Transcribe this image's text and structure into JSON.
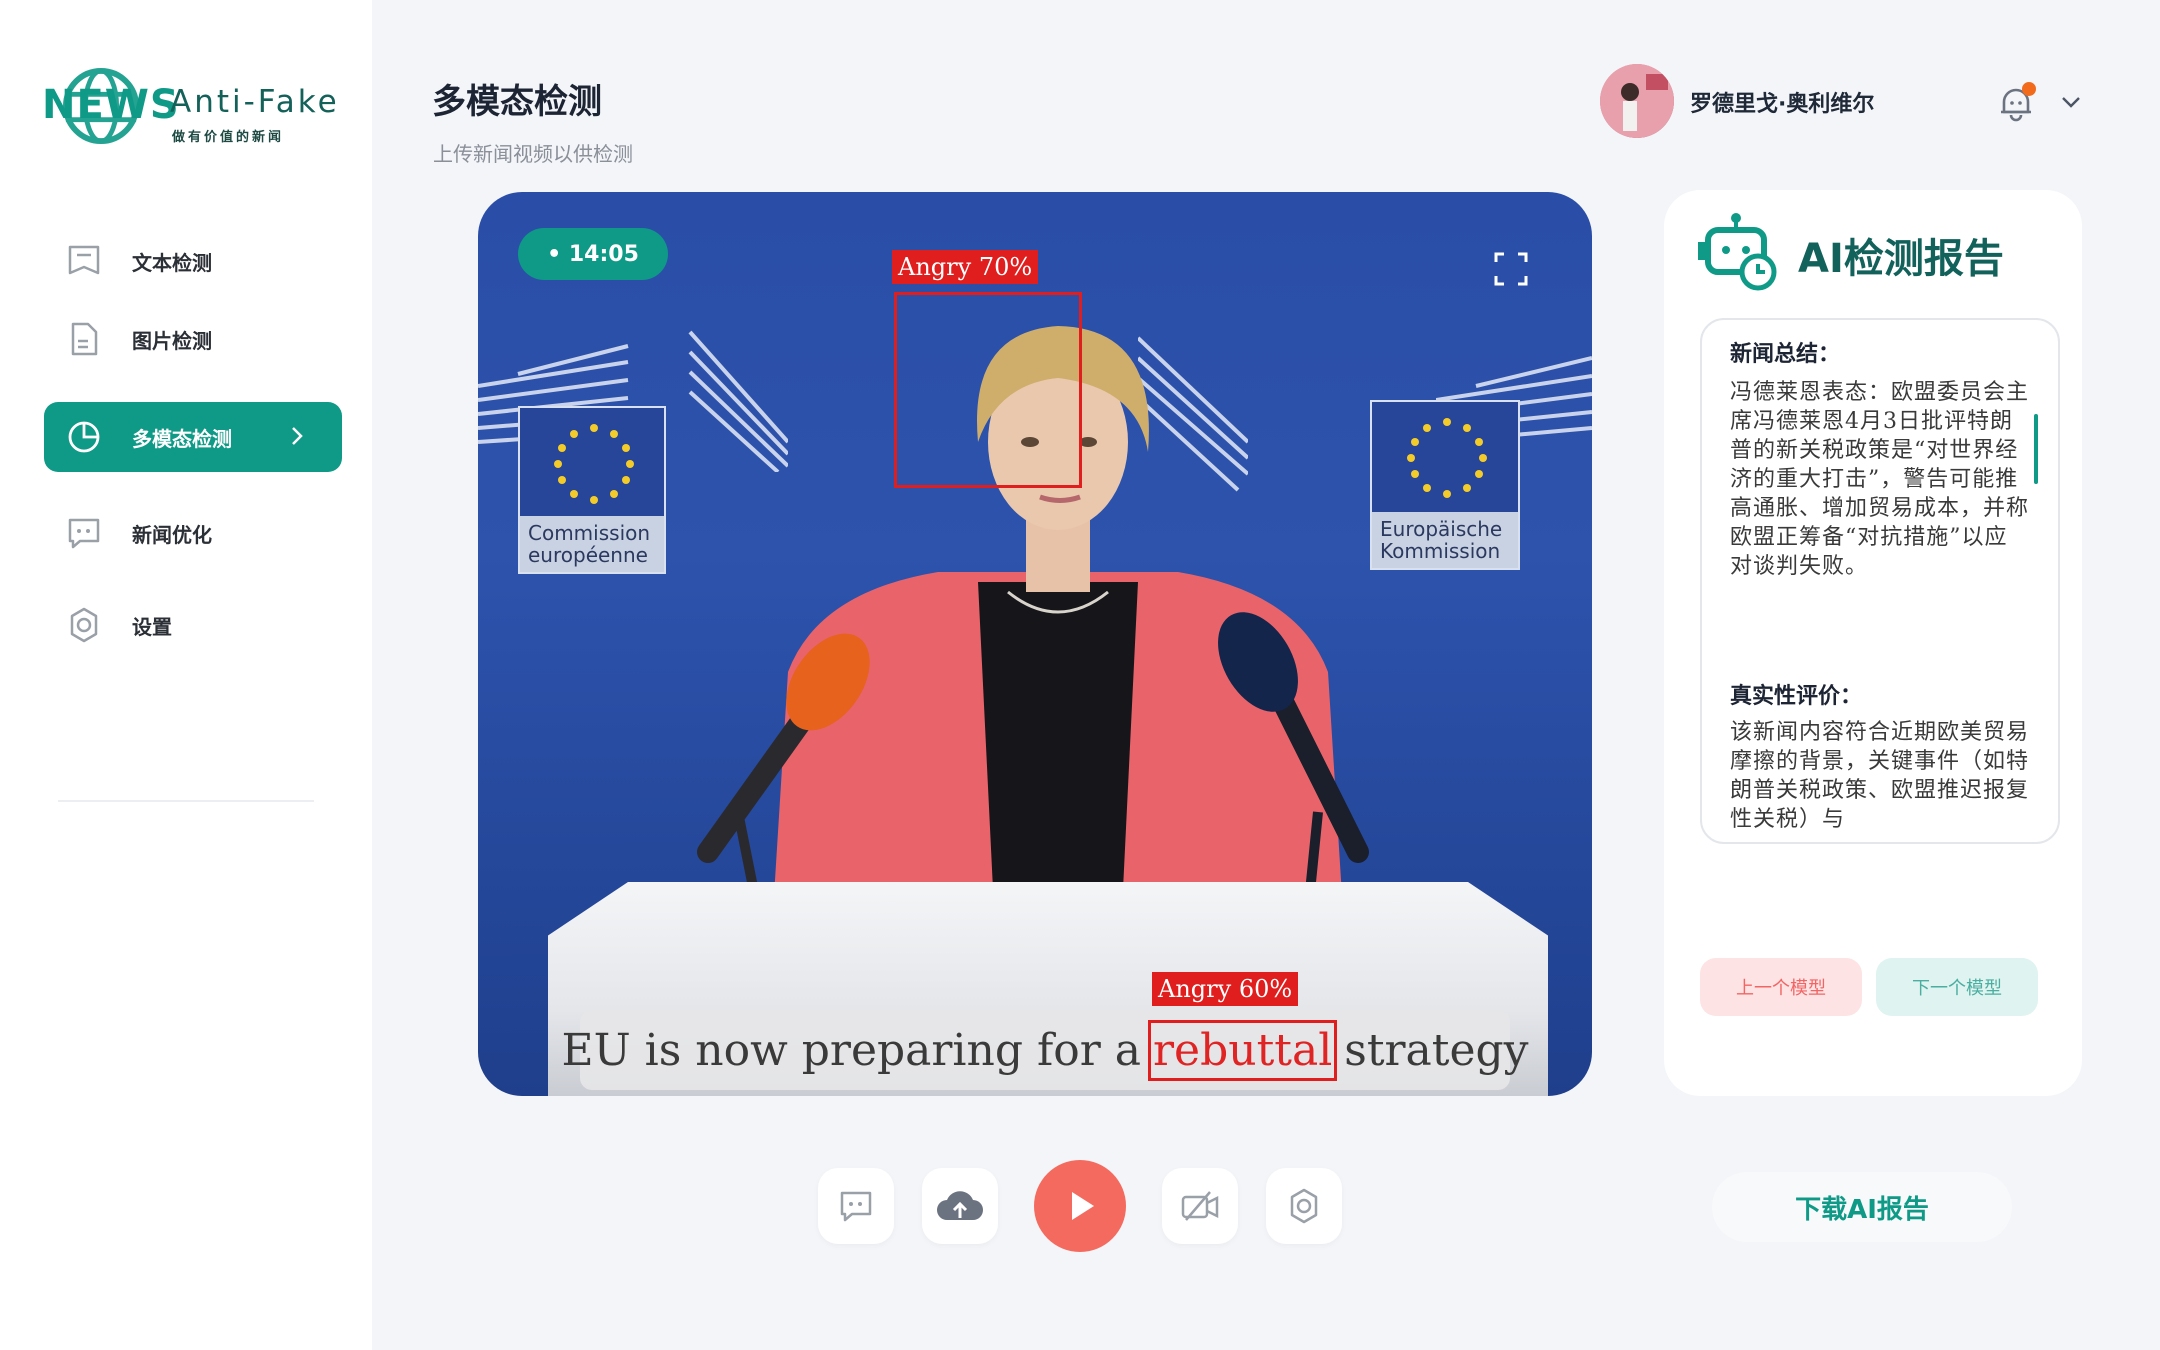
{
  "brand": {
    "news": "NEWS",
    "title": "Anti-Fake",
    "slogan": "做有价值的新闻"
  },
  "nav": {
    "items": [
      {
        "label": "文本检测",
        "icon": "flag-doc-icon"
      },
      {
        "label": "图片检测",
        "icon": "document-icon"
      },
      {
        "label": "多模态检测",
        "icon": "pie-chart-icon",
        "active": true
      },
      {
        "label": "新闻优化",
        "icon": "chat-icon"
      },
      {
        "label": "设置",
        "icon": "gear-icon"
      }
    ]
  },
  "header": {
    "title": "多模态检测",
    "subtitle": "上传新闻视频以供检测"
  },
  "user": {
    "name": "罗德里戈·奥利维尔"
  },
  "video": {
    "time": "• 14:05",
    "flag_left": "Commission européenne",
    "flag_right": "Europäische Kommission",
    "face_label": "Angry 70%",
    "word_label": "Angry 60%",
    "subtitle_before": "EU is now preparing for a",
    "subtitle_highlight": "rebuttal",
    "subtitle_after": "strategy"
  },
  "report": {
    "title": "AI检测报告",
    "summary_heading": "新闻总结：",
    "summary_text": "冯德莱恩表态：欧盟委员会主席冯德莱恩4月3日批评特朗普的新关税政策是“对世界经济的重大打击”，警告可能推高通胀、增加贸易成本，并称欧盟正筹备“对抗措施”以应对谈判失败。",
    "eval_heading": "真实性评价：",
    "eval_text": "该新闻内容符合近期欧美贸易摩擦的背景，关键事件（如特朗普关税政策、欧盟推迟报复性关税）与",
    "prev_label": "上一个模型",
    "next_label": "下一个模型",
    "download_label": "下载AI报告"
  },
  "colors": {
    "accent": "#0e9a87",
    "play": "#f46a5e",
    "alert": "#e01e1e"
  }
}
